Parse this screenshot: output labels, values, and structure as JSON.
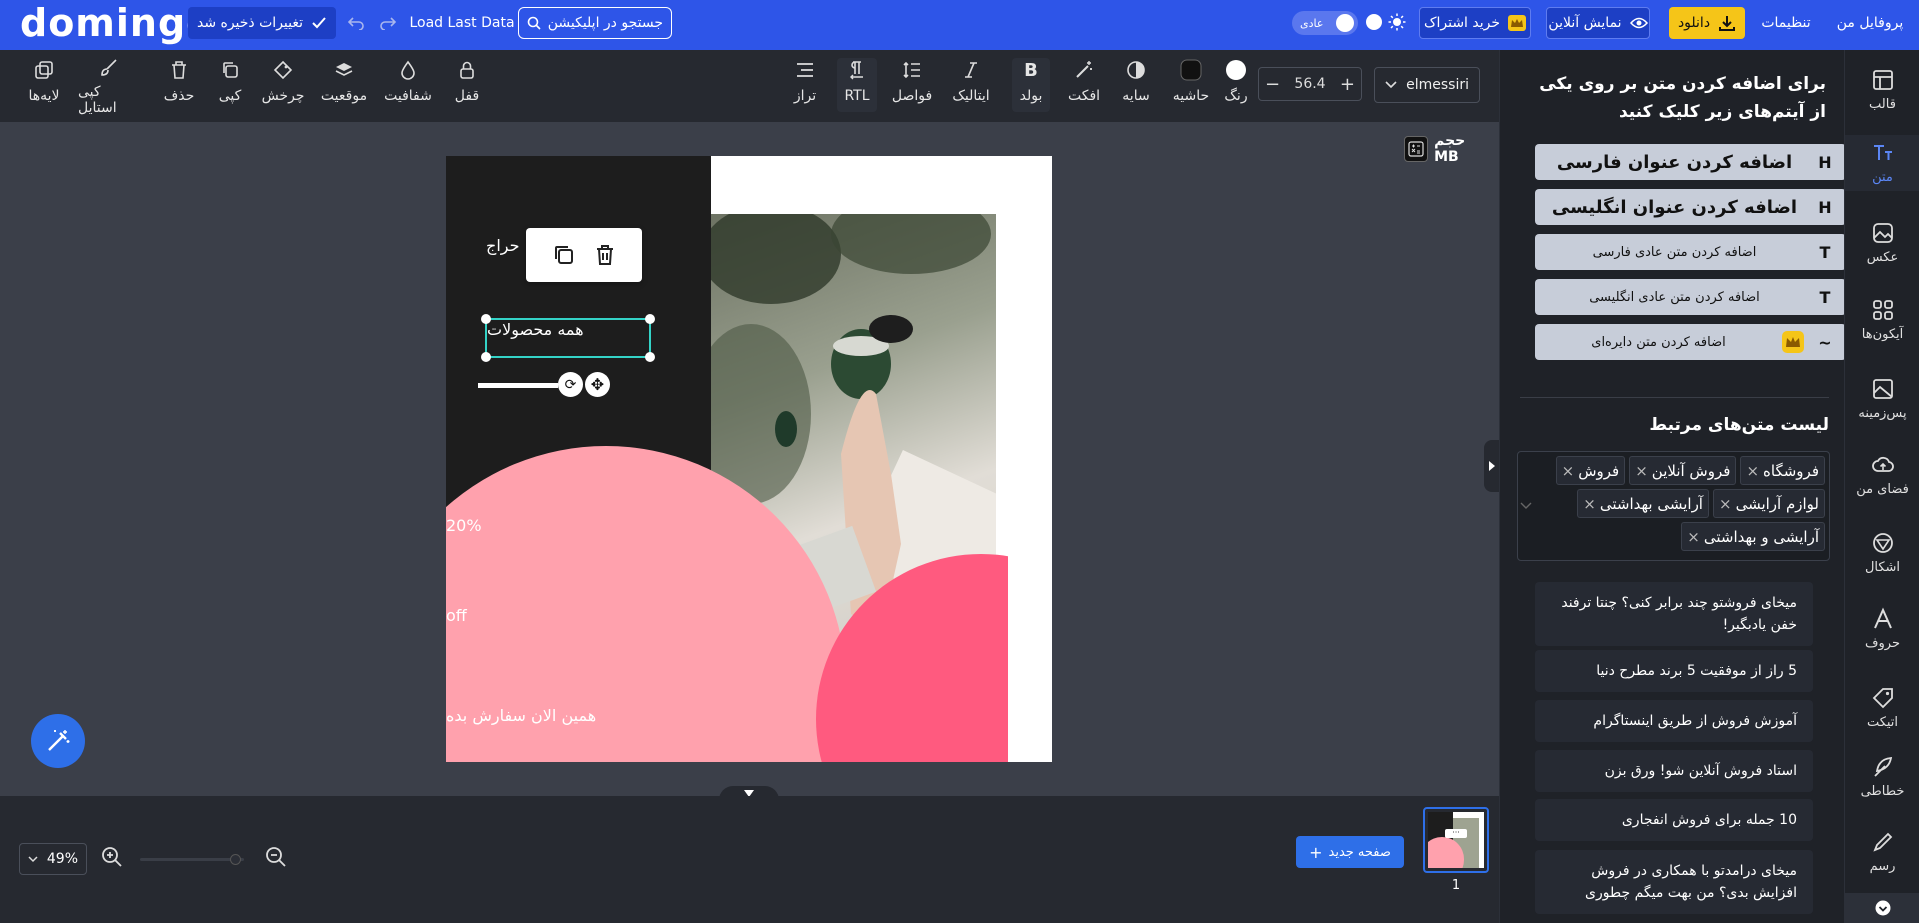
{
  "topbar": {
    "logo": "domingo",
    "save_label": "تغییرات ذخیره شد",
    "load_last": "Load Last Data",
    "search_placeholder": "جستجو در اپلیکیشن...",
    "mode_label": "عادی",
    "subscribe_label": "خرید اشتراک",
    "preview_label": "نمایش آنلاین",
    "download_label": "دانلود",
    "settings_label": "تنظیمات",
    "profile_label": "پروفایل من"
  },
  "toolbar": {
    "font_name": "elmessiri",
    "font_size": "56.4",
    "color_label": "رنگ",
    "border_label": "حاشیه",
    "shadow_label": "سایه",
    "effect_label": "افکت",
    "bold_label": "بولد",
    "italic_label": "ایتالیک",
    "spacing_label": "فواصل",
    "rtl_label": "RTL",
    "align_label": "تراز",
    "lock_label": "قفل",
    "opacity_label": "شفافیت",
    "position_label": "موقعیت",
    "rotate_label": "چرخش",
    "copy_label": "کپی",
    "delete_label": "حذف",
    "copy_style_label": "کپی استایل",
    "layers_label": "لایه‌ها"
  },
  "canvas": {
    "size_label": "حجم MB",
    "headline": "حراج",
    "selected_text": "همه محصولات",
    "discount_line1": "20%",
    "discount_line2": "off",
    "cta": "همین الان سفارش بده"
  },
  "bottom": {
    "zoom": "49%",
    "new_page_label": "صفحه جدید",
    "page_number": "1"
  },
  "panel": {
    "instruction": "برای اضافه کردن متن بر روی یکی از آیتم‌های زیر کلیک کنید",
    "add_buttons": [
      {
        "symbol": "H",
        "label": "اضافه کردن عنوان فارسی"
      },
      {
        "symbol": "H",
        "label": "اضافه کردن عنوان انگلیسی"
      },
      {
        "symbol": "T",
        "label": "اضافه کردن متن عادی فارسی"
      },
      {
        "symbol": "T",
        "label": "اضافه کردن متن عادی انگلیسی"
      },
      {
        "symbol": "~",
        "label": "اضافه کردن متن دایره‌ای"
      }
    ],
    "related_title": "لیست متن‌های مرتبط",
    "tags": [
      "فروشگاه",
      "فروش آنلاین",
      "فروش",
      "لوازم آرایشی",
      "آرایشی بهداشتی",
      "آرایشی و بهداشتی"
    ],
    "related_items": [
      "میخای فروشتو چند برابر کنی؟ چنتا ترفند خفن یادبگیر!",
      "5 راز از موفقیت 5 برند مطرح دنیا",
      "آموزش فروش از طریق اینستاگرام",
      "استاد فروش آنلاین شو! ورق بزن",
      "10 جمله برای فروش انفجاری",
      "میخای درامدتو با همکاری در فروش افزایش بدی؟ من بهت میگم چطوری"
    ]
  },
  "rail": {
    "items": [
      "قالب",
      "متن",
      "عکس",
      "آیکون‌ها",
      "پس‌زمینه",
      "فضای من",
      "اشکال",
      "حروف",
      "اتیکت",
      "خطاطی",
      "رسم"
    ]
  },
  "colors": {
    "brand": "#2e55e8",
    "accent_yellow": "#f5c518",
    "pink": "#ffa1ad",
    "hot_pink": "#ff5a7f"
  }
}
